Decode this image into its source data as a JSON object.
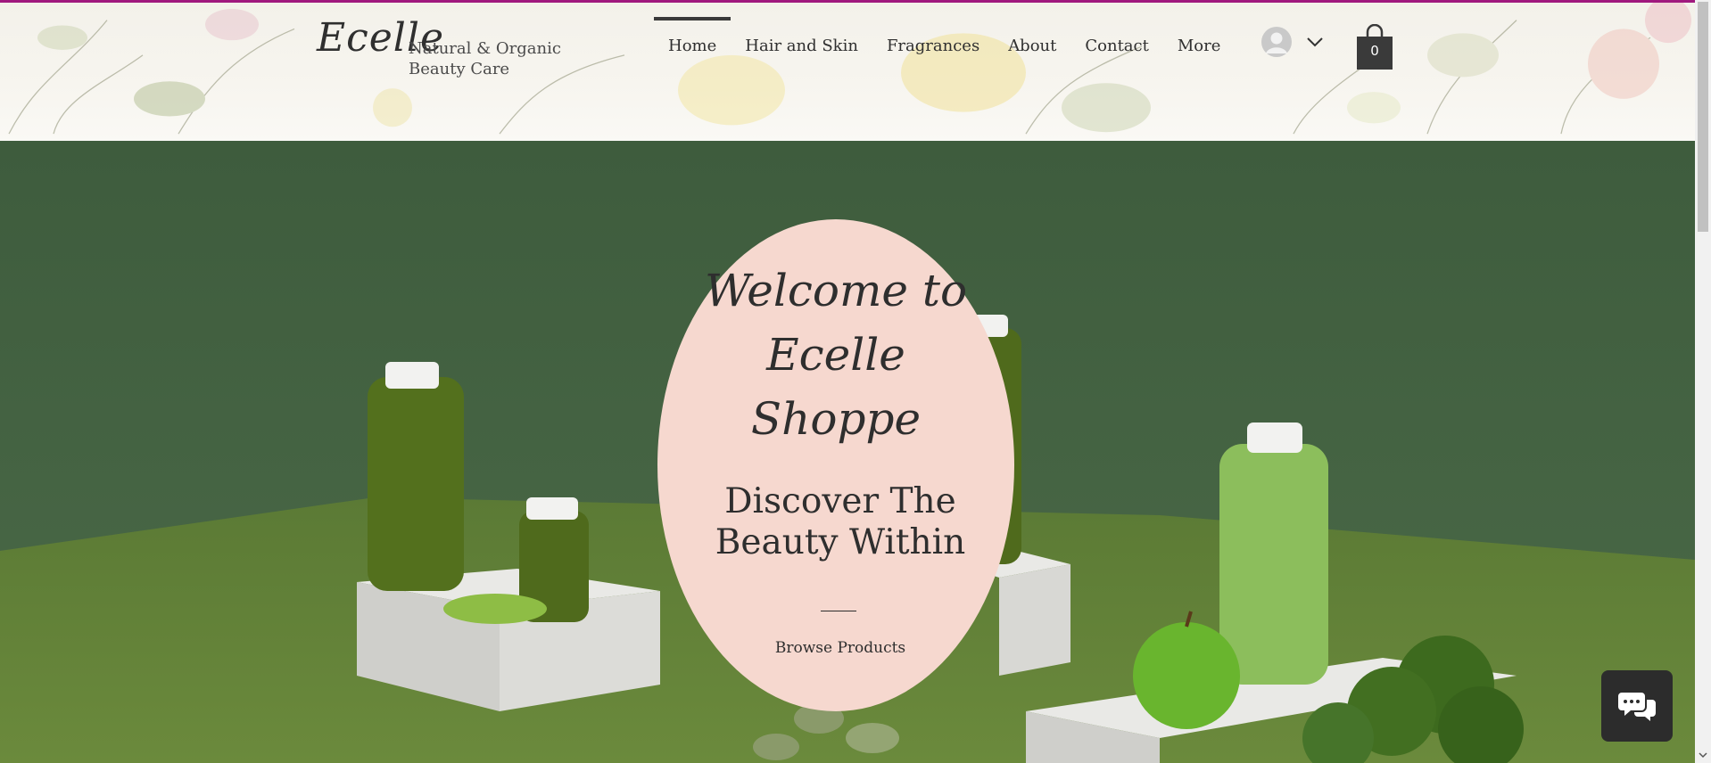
{
  "header": {
    "logo": "Ecelle",
    "tagline": "Natural & Organic Beauty Care",
    "accent_color": "#a0197e",
    "nav": [
      {
        "label": "Home",
        "active": true
      },
      {
        "label": "Hair and Skin",
        "active": false
      },
      {
        "label": "Fragrances",
        "active": false
      },
      {
        "label": "About",
        "active": false
      },
      {
        "label": "Contact",
        "active": false
      },
      {
        "label": "More",
        "active": false
      }
    ],
    "account_icon": "user-avatar-icon",
    "cart": {
      "icon": "shopping-bag-icon",
      "count": "0"
    }
  },
  "hero": {
    "welcome_line1": "Welcome to",
    "welcome_line2": "Ecelle",
    "welcome_line3": "Shoppe",
    "headline_line1": "Discover The",
    "headline_line2": "Beauty Within",
    "cta": "Browse Products",
    "oval_color": "#f6d8cf",
    "background_color": "#3f5f3f"
  },
  "chat": {
    "icon": "chat-bubbles-icon"
  }
}
